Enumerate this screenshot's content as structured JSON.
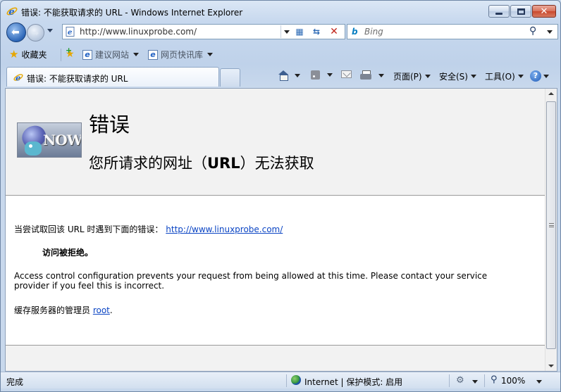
{
  "window": {
    "title": "错误: 不能获取请求的 URL - Windows Internet Explorer"
  },
  "navigation": {
    "address": "http://www.linuxprobe.com/",
    "search_placeholder": "Bing",
    "search_engine_icon": "bing-logo"
  },
  "favorites_bar": {
    "favorites_label": "收藏夹",
    "items": [
      {
        "label": "建议网站",
        "icon": "ie-page-icon"
      },
      {
        "label": "网页快讯库",
        "icon": "ie-page-icon"
      }
    ]
  },
  "tabs": [
    {
      "label": "错误: 不能获取请求的 URL",
      "active": true
    }
  ],
  "command_bar": {
    "page": "页面(P)",
    "safety": "安全(S)",
    "tools": "工具(O)",
    "help_glyph": "?"
  },
  "page": {
    "heading": "错误",
    "subheading_prefix": "您所请求的网址（",
    "subheading_bold": "URL",
    "subheading_suffix": "）无法获取",
    "logo_text": "NOW",
    "intro_text": "当尝试取回该  URL 时遇到下面的错误：",
    "intro_link": "http://www.linuxprobe.com/",
    "error_detail": "访问被拒绝。",
    "message_line1": "Access control configuration prevents your request from being allowed at this time. Please contact your service",
    "message_line2": "provider if you feel this is incorrect.",
    "admin_text": "缓存服务器的管理员 ",
    "admin_link": "root",
    "admin_suffix": "."
  },
  "status_bar": {
    "status": "完成",
    "zone": "Internet | 保护模式: 启用",
    "zoom": "100%"
  },
  "colors": {
    "link": "#0b45c4",
    "page_header_bg": "#f2f2f2",
    "chrome_blue": "#c9d9ec"
  }
}
